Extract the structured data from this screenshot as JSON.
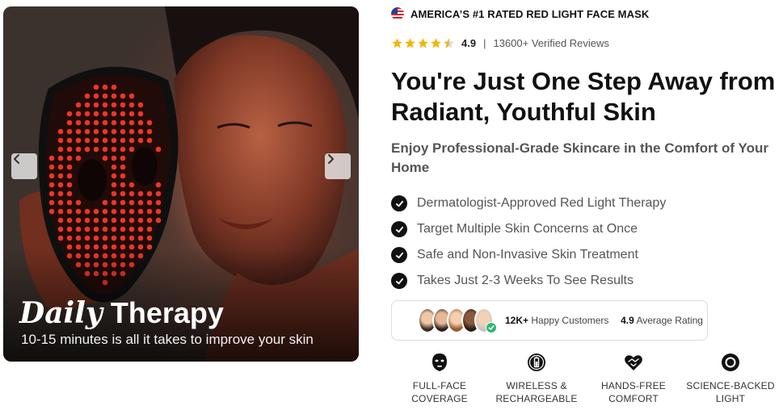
{
  "hero": {
    "title_italic": "Daily",
    "title_bold": "Therapy",
    "subtitle": "10-15 minutes is all it takes to improve your skin",
    "prev_icon": "chevron-left-icon",
    "next_icon": "chevron-right-icon"
  },
  "badge": {
    "flag_icon": "us-flag-icon",
    "text": "AMERICA’S #1 RATED RED LIGHT FACE MASK"
  },
  "rating": {
    "stars": 4.5,
    "star_color": "#f5b40a",
    "score": "4.9",
    "separator": "|",
    "reviews": "13600+ Verified Reviews"
  },
  "headline": "You're Just One Step Away from Radiant, Youthful Skin",
  "subheadline": "Enjoy Professional-Grade Skincare in the Comfort of Your Home",
  "benefits": [
    "Dermatologist-Approved Red Light Therapy",
    "Target Multiple Skin Concerns at Once",
    "Safe and Non-Invasive Skin Treatment",
    "Takes Just 2-3 Weeks To See Results"
  ],
  "social_proof": {
    "customers_bold": "12K+",
    "customers_text": "Happy Customers",
    "rating_bold": "4.9",
    "rating_text": "Average Rating"
  },
  "features": [
    {
      "icon": "face-mask-icon",
      "label": "FULL-FACE\nCOVERAGE"
    },
    {
      "icon": "battery-icon",
      "label": "WIRELESS &\nRECHARGEABLE"
    },
    {
      "icon": "handshake-heart-icon",
      "label": "HANDS-FREE\nCOMFORT"
    },
    {
      "icon": "light-ring-icon",
      "label": "SCIENCE-BACKED\nLIGHT"
    }
  ],
  "colors": {
    "accent_dark": "#111111",
    "text_muted": "#555555",
    "led_red": "#ff3b2a",
    "verified_green": "#2eb872"
  }
}
